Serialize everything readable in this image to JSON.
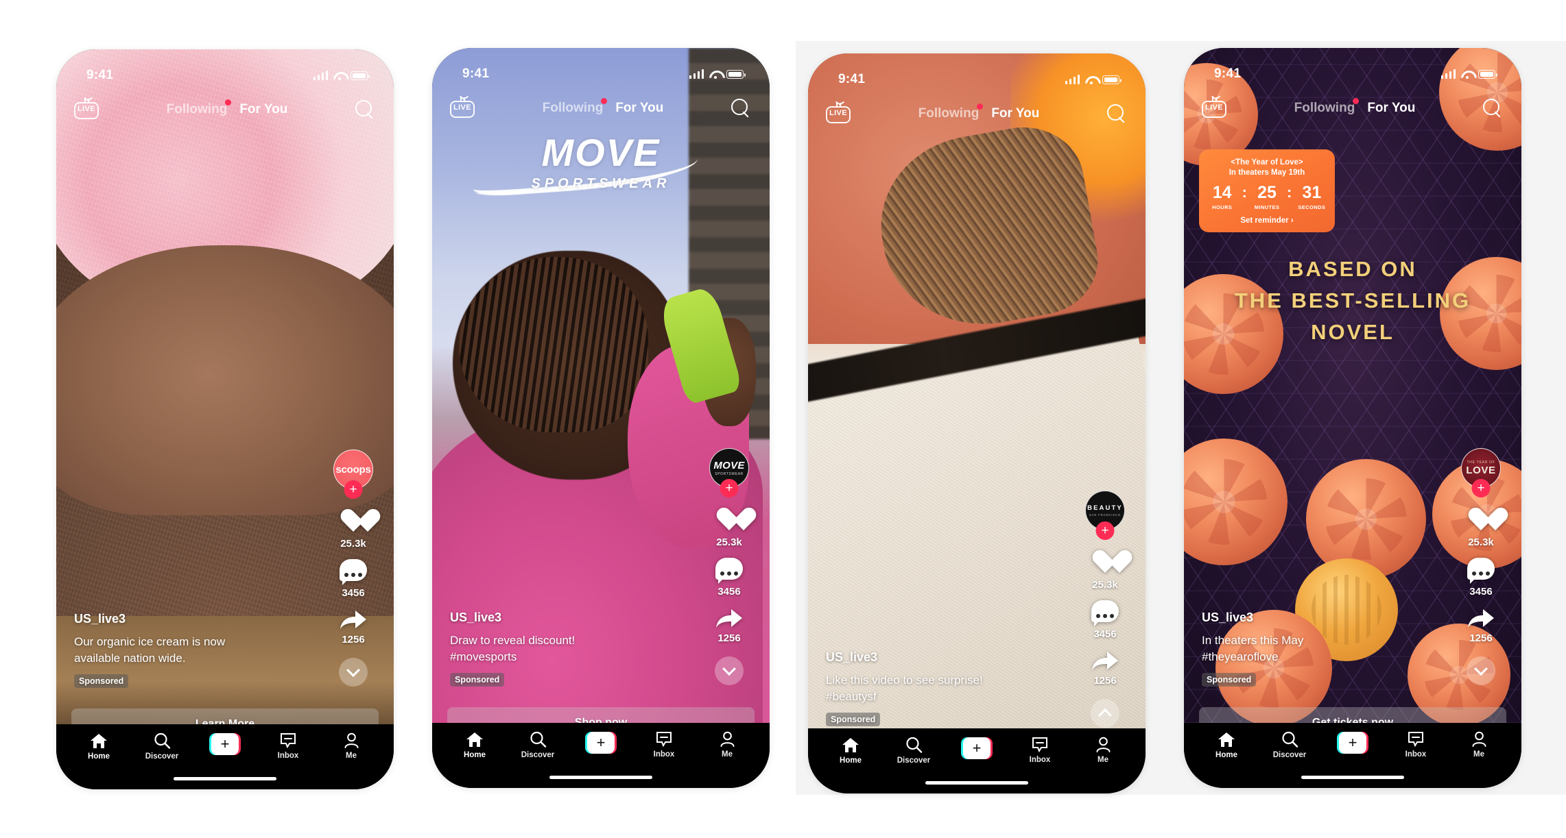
{
  "status_bar": {
    "time": "9:41"
  },
  "top_nav": {
    "live_label": "LIVE",
    "following_label": "Following",
    "for_you_label": "For You"
  },
  "bottom_nav": {
    "home": "Home",
    "discover": "Discover",
    "create": "+",
    "inbox": "Inbox",
    "me": "Me"
  },
  "accent_colors": {
    "tiktok_red": "#fe2c55",
    "tiktok_cyan": "#25f4ee",
    "countdown_orange": "#fa7433",
    "hero_gold": "#f3d07a"
  },
  "phones": [
    {
      "id": "ice-cream-ad",
      "avatar": {
        "label": "scoops",
        "sub": "",
        "style": "coral"
      },
      "like_count": "25.3k",
      "comment_count": "3456",
      "share_count": "1256",
      "expand_direction": "down",
      "username": "US_live3",
      "caption_line1": "Our organic ice cream is now",
      "caption_line2": "available nation wide.",
      "sponsored_label": "Sponsored",
      "cta_label": "Learn More"
    },
    {
      "id": "move-sportswear-ad",
      "brand_logo_main": "MOVE",
      "brand_logo_sub": "SPORTSWEAR",
      "avatar": {
        "label": "MOVE",
        "sub": "SPORTSWEAR",
        "style": "black-move"
      },
      "like_count": "25.3k",
      "comment_count": "3456",
      "share_count": "1256",
      "expand_direction": "down",
      "username": "US_live3",
      "caption_line1": "Draw to reveal discount!",
      "caption_line2": "#movesports",
      "sponsored_label": "Sponsored",
      "cta_label": "Shop now"
    },
    {
      "id": "beauty-sf-ad",
      "avatar": {
        "label": "BEAUTY",
        "sub": "SAN FRANCISCO",
        "style": "black-beauty"
      },
      "like_count": "25.3k",
      "comment_count": "3456",
      "share_count": "1256",
      "expand_direction": "up",
      "username": "US_live3",
      "caption_line1": "Like this video to see surprise!",
      "caption_line2": "#beautysf",
      "sponsored_label": "Sponsored",
      "cta_label": ""
    },
    {
      "id": "year-of-love-ad",
      "countdown": {
        "title_line1": "<The Year of Love>",
        "title_line2": "In theaters May 19th",
        "hours_value": "14",
        "minutes_value": "25",
        "seconds_value": "31",
        "hours_label": "HOURS",
        "minutes_label": "MINUTES",
        "seconds_label": "SECONDS",
        "separator": ":",
        "cta": "Set reminder  ›"
      },
      "hero_line1": "BASED ON",
      "hero_line2": "THE BEST-SELLING",
      "hero_line3": "NOVEL",
      "avatar": {
        "label": "LOVE",
        "sub": "THE YEAR OF",
        "style": "love"
      },
      "like_count": "25.3k",
      "comment_count": "3456",
      "share_count": "1256",
      "expand_direction": "down",
      "username": "US_live3",
      "caption_line1": "In theaters this May",
      "caption_line2": "#theyearoflove",
      "sponsored_label": "Sponsored",
      "cta_label": "Get tickets now"
    }
  ]
}
